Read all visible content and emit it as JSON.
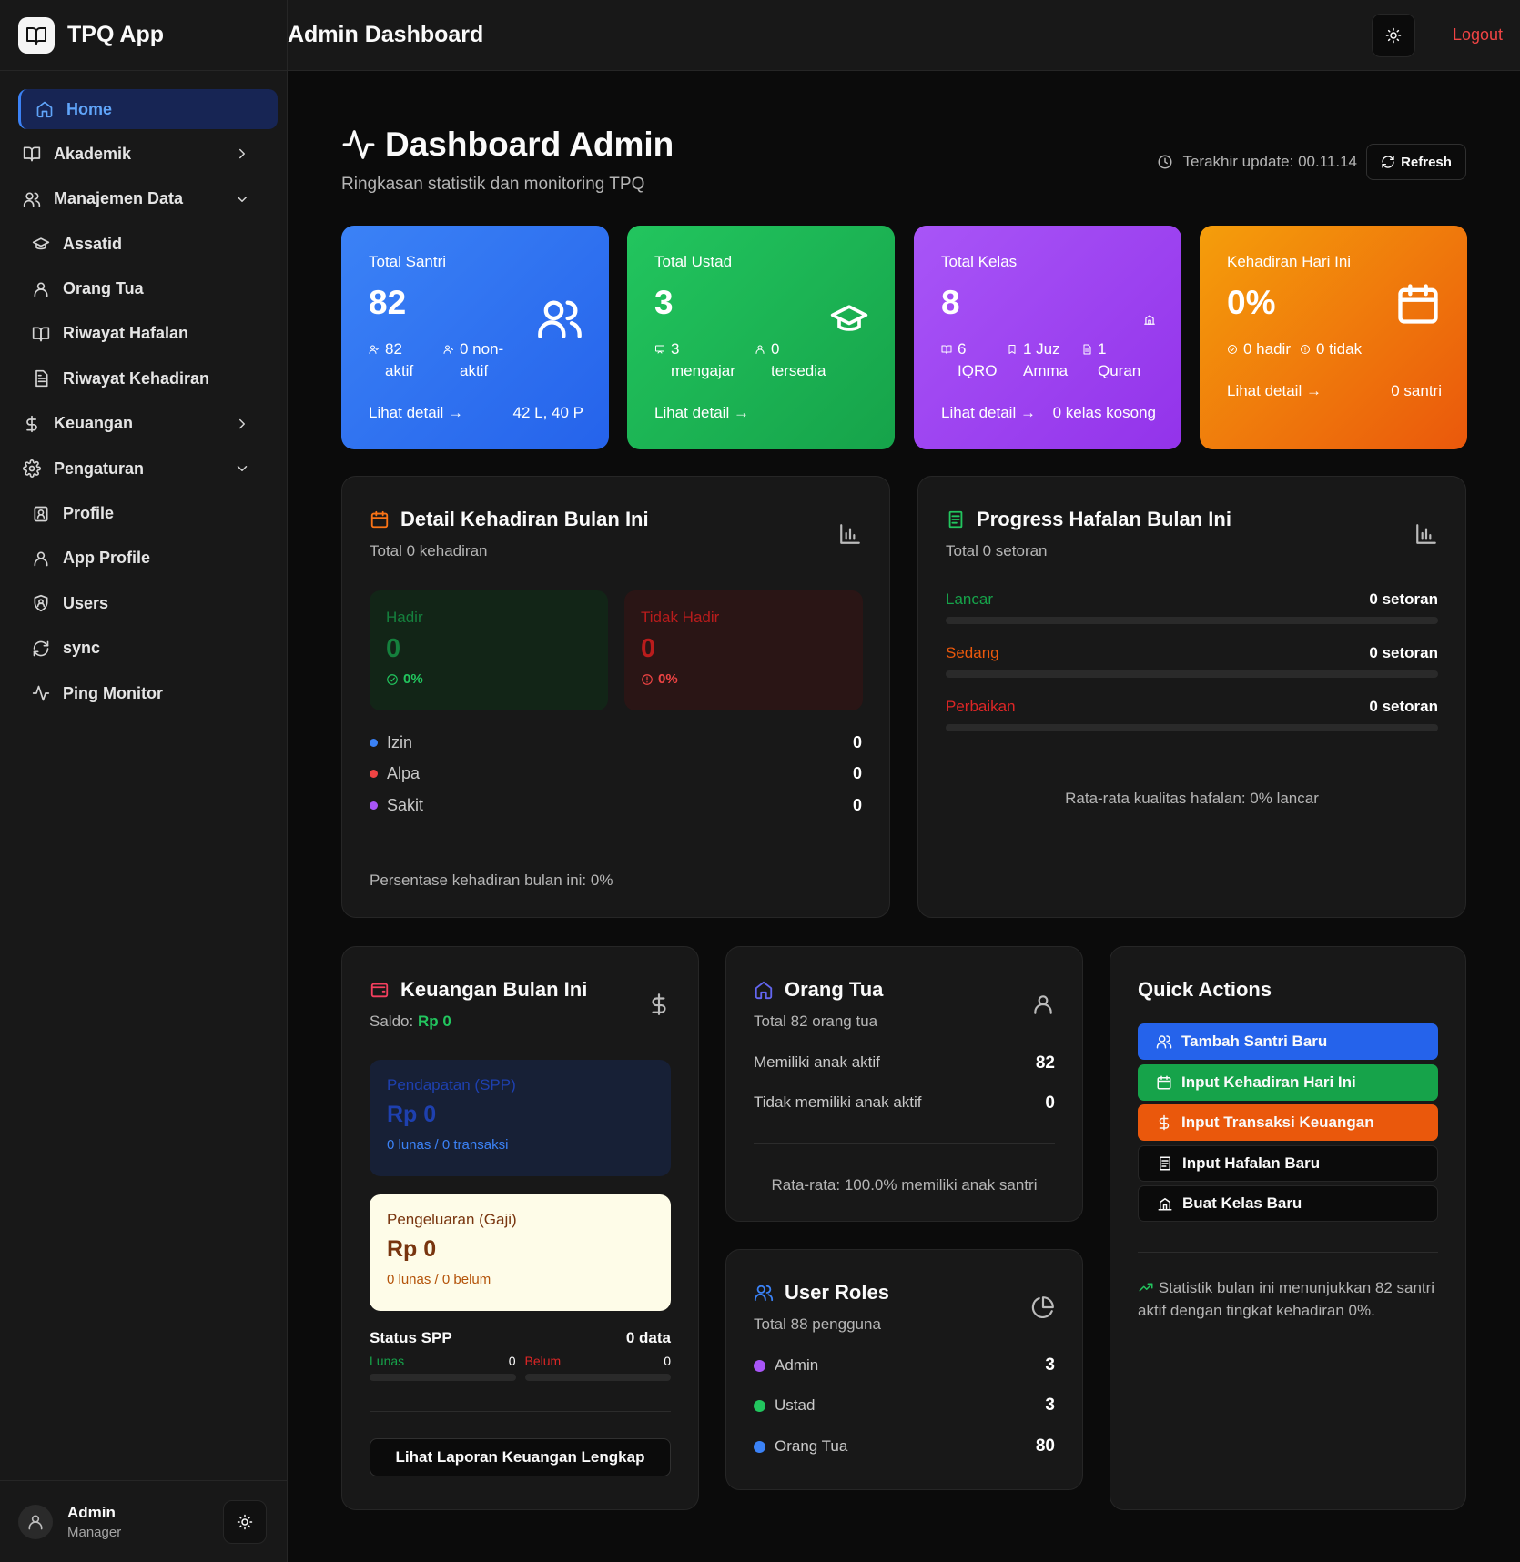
{
  "app": {
    "name": "TPQ App",
    "header_title": "Admin Dashboard",
    "logout_label": "Logout"
  },
  "sidebar": {
    "items": [
      {
        "label": "Home",
        "icon": "home-icon",
        "active": true
      },
      {
        "label": "Akademik",
        "icon": "book-icon",
        "chevron": "right"
      },
      {
        "label": "Manajemen Data",
        "icon": "users-icon",
        "chevron": "down"
      },
      {
        "label": "Assatid",
        "icon": "graduation-cap-icon",
        "sub": true
      },
      {
        "label": "Orang Tua",
        "icon": "user-icon",
        "sub": true
      },
      {
        "label": "Riwayat Hafalan",
        "icon": "book-icon",
        "sub": true
      },
      {
        "label": "Riwayat Kehadiran",
        "icon": "file-text-icon",
        "sub": true
      },
      {
        "label": "Keuangan",
        "icon": "dollar-icon",
        "chevron": "right"
      },
      {
        "label": "Pengaturan",
        "icon": "gear-icon",
        "chevron": "down"
      },
      {
        "label": "Profile",
        "icon": "id-badge-icon",
        "sub": true
      },
      {
        "label": "App Profile",
        "icon": "user-icon",
        "sub": true
      },
      {
        "label": "Users",
        "icon": "user-shield-icon",
        "sub": true
      },
      {
        "label": "sync",
        "icon": "refresh-icon",
        "sub": true
      },
      {
        "label": "Ping Monitor",
        "icon": "activity-icon",
        "sub": true
      }
    ],
    "user": {
      "name": "Admin",
      "role": "Manager"
    }
  },
  "page": {
    "title": "Dashboard Admin",
    "subtitle": "Ringkasan statistik dan monitoring TPQ",
    "last_update": "Terakhir update: 00.11.14",
    "refresh_label": "Refresh"
  },
  "stats": {
    "santri": {
      "label": "Total Santri",
      "value": "82",
      "sub1": "82 aktif",
      "sub2": "0 non-aktif",
      "link": "Lihat detail →",
      "extra": "42 L, 40 P"
    },
    "ustad": {
      "label": "Total Ustad",
      "value": "3",
      "sub1": "3 mengajar",
      "sub2": "0 tersedia",
      "link": "Lihat detail →",
      "extra": ""
    },
    "kelas": {
      "label": "Total Kelas",
      "value": "8",
      "sub1": "6 IQRO",
      "sub2": "1 Juz Amma",
      "sub3": "1 Quran",
      "link": "Lihat detail →",
      "extra": "0 kelas kosong"
    },
    "kehadiran": {
      "label": "Kehadiran Hari Ini",
      "value": "0%",
      "sub1": "0 hadir",
      "sub2": "0 tidak",
      "link": "Lihat detail →",
      "extra": "0 santri"
    }
  },
  "attendance": {
    "title": "Detail Kehadiran Bulan Ini",
    "subtitle": "Total 0 kehadiran",
    "hadir": {
      "label": "Hadir",
      "value": "0",
      "pct": "0%"
    },
    "tidak_hadir": {
      "label": "Tidak Hadir",
      "value": "0",
      "pct": "0%"
    },
    "rows": [
      {
        "label": "Izin",
        "value": "0",
        "color": "#3b82f6"
      },
      {
        "label": "Alpa",
        "value": "0",
        "color": "#ef4444"
      },
      {
        "label": "Sakit",
        "value": "0",
        "color": "#a855f7"
      }
    ],
    "footer": "Persentase kehadiran bulan ini: 0%"
  },
  "hafalan": {
    "title": "Progress Hafalan Bulan Ini",
    "subtitle": "Total 0 setoran",
    "rows": [
      {
        "label": "Lancar",
        "value": "0 setoran",
        "color": "#16a34a",
        "progress": 0
      },
      {
        "label": "Sedang",
        "value": "0 setoran",
        "color": "#ea580c",
        "progress": 0
      },
      {
        "label": "Perbaikan",
        "value": "0 setoran",
        "color": "#dc2626",
        "progress": 0
      }
    ],
    "footer": "Rata-rata kualitas hafalan: 0% lancar"
  },
  "finance": {
    "title": "Keuangan Bulan Ini",
    "saldo_label": "Saldo:",
    "saldo_value": "Rp 0",
    "pendapatan": {
      "label": "Pendapatan (SPP)",
      "value": "Rp 0",
      "note": "0 lunas / 0 transaksi"
    },
    "pengeluaran": {
      "label": "Pengeluaran (Gaji)",
      "value": "Rp 0",
      "note": "0 lunas / 0 belum"
    },
    "spp": {
      "label": "Status SPP",
      "count": "0 data",
      "lunas_label": "Lunas",
      "lunas_value": "0",
      "lunas_progress": 0,
      "belum_label": "Belum",
      "belum_value": "0",
      "belum_progress": 0
    },
    "button": "Lihat Laporan Keuangan Lengkap"
  },
  "parents": {
    "title": "Orang Tua",
    "subtitle": "Total 82 orang tua",
    "rows": [
      {
        "label": "Memiliki anak aktif",
        "value": "82"
      },
      {
        "label": "Tidak memiliki anak aktif",
        "value": "0"
      }
    ],
    "footer": "Rata-rata: 100.0% memiliki anak santri"
  },
  "roles": {
    "title": "User Roles",
    "subtitle": "Total 88 pengguna",
    "rows": [
      {
        "label": "Admin",
        "value": "3",
        "color": "#a855f7"
      },
      {
        "label": "Ustad",
        "value": "3",
        "color": "#22c55e"
      },
      {
        "label": "Orang Tua",
        "value": "80",
        "color": "#3b82f6"
      }
    ]
  },
  "quick_actions": {
    "title": "Quick Actions",
    "buttons": [
      {
        "label": "Tambah Santri Baru",
        "icon": "users-icon",
        "bg": "#2563eb"
      },
      {
        "label": "Input Kehadiran Hari Ini",
        "icon": "calendar-icon",
        "bg": "#16a34a"
      },
      {
        "label": "Input Transaksi Keuangan",
        "icon": "dollar-icon",
        "bg": "#ea580c"
      },
      {
        "label": "Input Hafalan Baru",
        "icon": "file-text-icon",
        "bg": "#0b0b0b"
      },
      {
        "label": "Buat Kelas Baru",
        "icon": "school-icon",
        "bg": "#0b0b0b"
      }
    ],
    "note": "Statistik bulan ini menunjukkan 82 santri aktif dengan tingkat kehadiran 0%."
  },
  "colors": {
    "accent": "#3b82f6",
    "danger": "#ef4444",
    "success": "#22c55e",
    "warning": "#ea580c",
    "purple": "#a855f7"
  }
}
